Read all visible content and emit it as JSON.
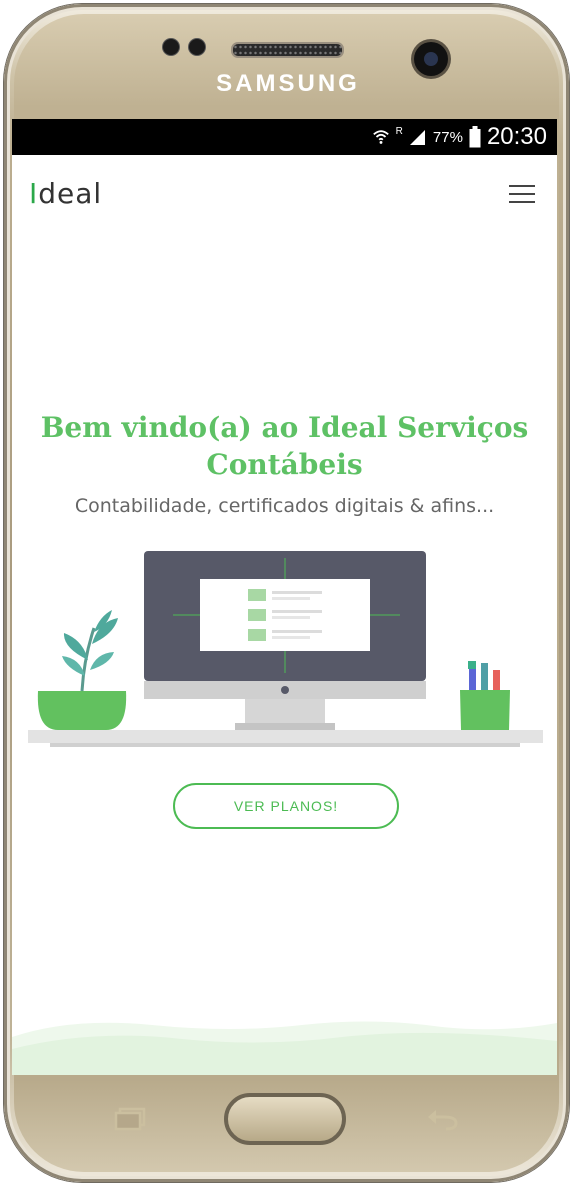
{
  "device": {
    "brand": "SAMSUNG"
  },
  "status_bar": {
    "battery": "77%",
    "time": "20:30",
    "network": "R"
  },
  "app": {
    "logo_first": "I",
    "logo_rest": "deal",
    "hero_title": "Bem vindo(a) ao Ideal Serviços Contábeis",
    "hero_subtitle": "Contabilidade, certificados digitais & afins...",
    "cta_label": "VER PLANOS!"
  },
  "colors": {
    "accent": "#5ec165",
    "button": "#4cbb53"
  }
}
